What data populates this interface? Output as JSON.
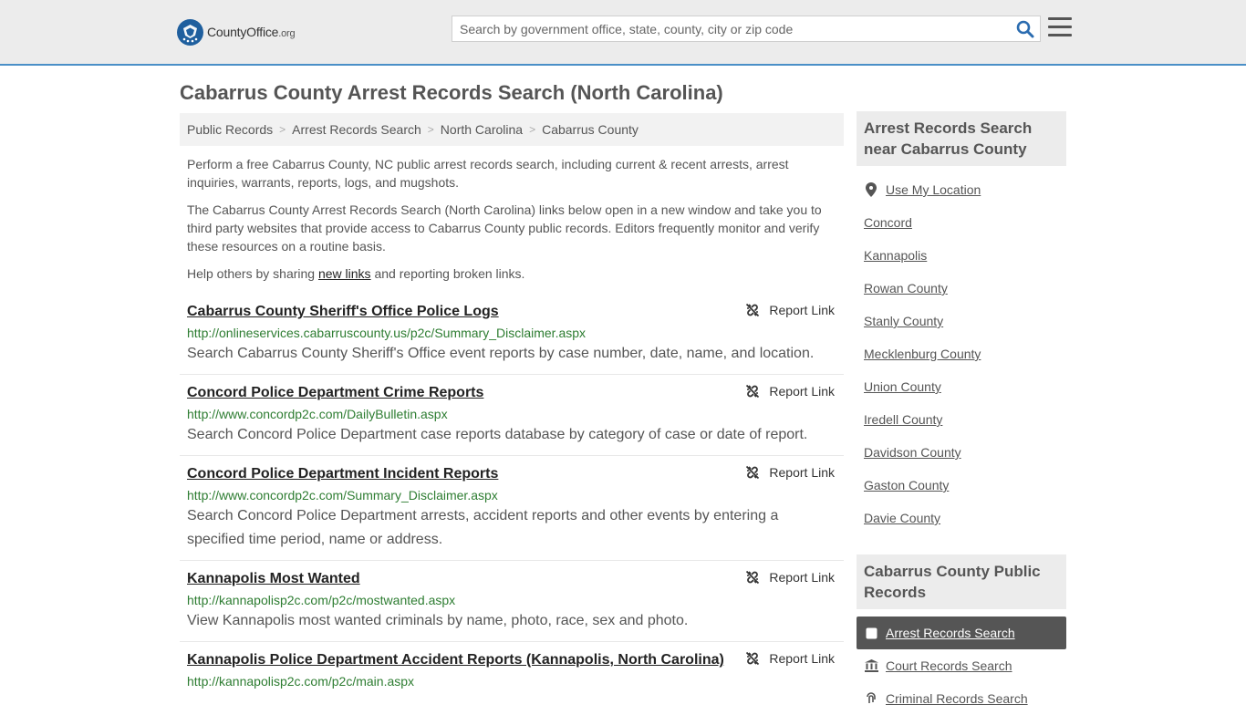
{
  "header": {
    "logo_main": "CountyOffice",
    "logo_tld": ".org",
    "search_placeholder": "Search by government office, state, county, city or zip code"
  },
  "page": {
    "title": "Cabarrus County Arrest Records Search (North Carolina)"
  },
  "breadcrumb": [
    "Public Records",
    "Arrest Records Search",
    "North Carolina",
    "Cabarrus County"
  ],
  "intro": {
    "p1": "Perform a free Cabarrus County, NC public arrest records search, including current & recent arrests, arrest inquiries, warrants, reports, logs, and mugshots.",
    "p2": "The Cabarrus County Arrest Records Search (North Carolina) links below open in a new window and take you to third party websites that provide access to Cabarrus County public records. Editors frequently monitor and verify these resources on a routine basis.",
    "p3_before": "Help others by sharing ",
    "p3_link": "new links",
    "p3_after": " and reporting broken links."
  },
  "report_label": "Report Link",
  "results": [
    {
      "title": "Cabarrus County Sheriff's Office Police Logs",
      "url": "http://onlineservices.cabarruscounty.us/p2c/Summary_Disclaimer.aspx",
      "desc": "Search Cabarrus County Sheriff's Office event reports by case number, date, name, and location."
    },
    {
      "title": "Concord Police Department Crime Reports",
      "url": "http://www.concordp2c.com/DailyBulletin.aspx",
      "desc": "Search Concord Police Department case reports database by category of case or date of report."
    },
    {
      "title": "Concord Police Department Incident Reports",
      "url": "http://www.concordp2c.com/Summary_Disclaimer.aspx",
      "desc": "Search Concord Police Department arrests, accident reports and other events by entering a specified time period, name or address."
    },
    {
      "title": "Kannapolis Most Wanted",
      "url": "http://kannapolisp2c.com/p2c/mostwanted.aspx",
      "desc": "View Kannapolis most wanted criminals by name, photo, race, sex and photo."
    },
    {
      "title": "Kannapolis Police Department Accident Reports (Kannapolis, North Carolina)",
      "url": "http://kannapolisp2c.com/p2c/main.aspx",
      "desc": ""
    }
  ],
  "sidebar": {
    "nearby_heading": "Arrest Records Search near Cabarrus County",
    "use_location": "Use My Location",
    "nearby": [
      "Concord",
      "Kannapolis",
      "Rowan County",
      "Stanly County",
      "Mecklenburg County",
      "Union County",
      "Iredell County",
      "Davidson County",
      "Gaston County",
      "Davie County"
    ],
    "records_heading": "Cabarrus County Public Records",
    "records": [
      "Arrest Records Search",
      "Court Records Search",
      "Criminal Records Search"
    ]
  }
}
